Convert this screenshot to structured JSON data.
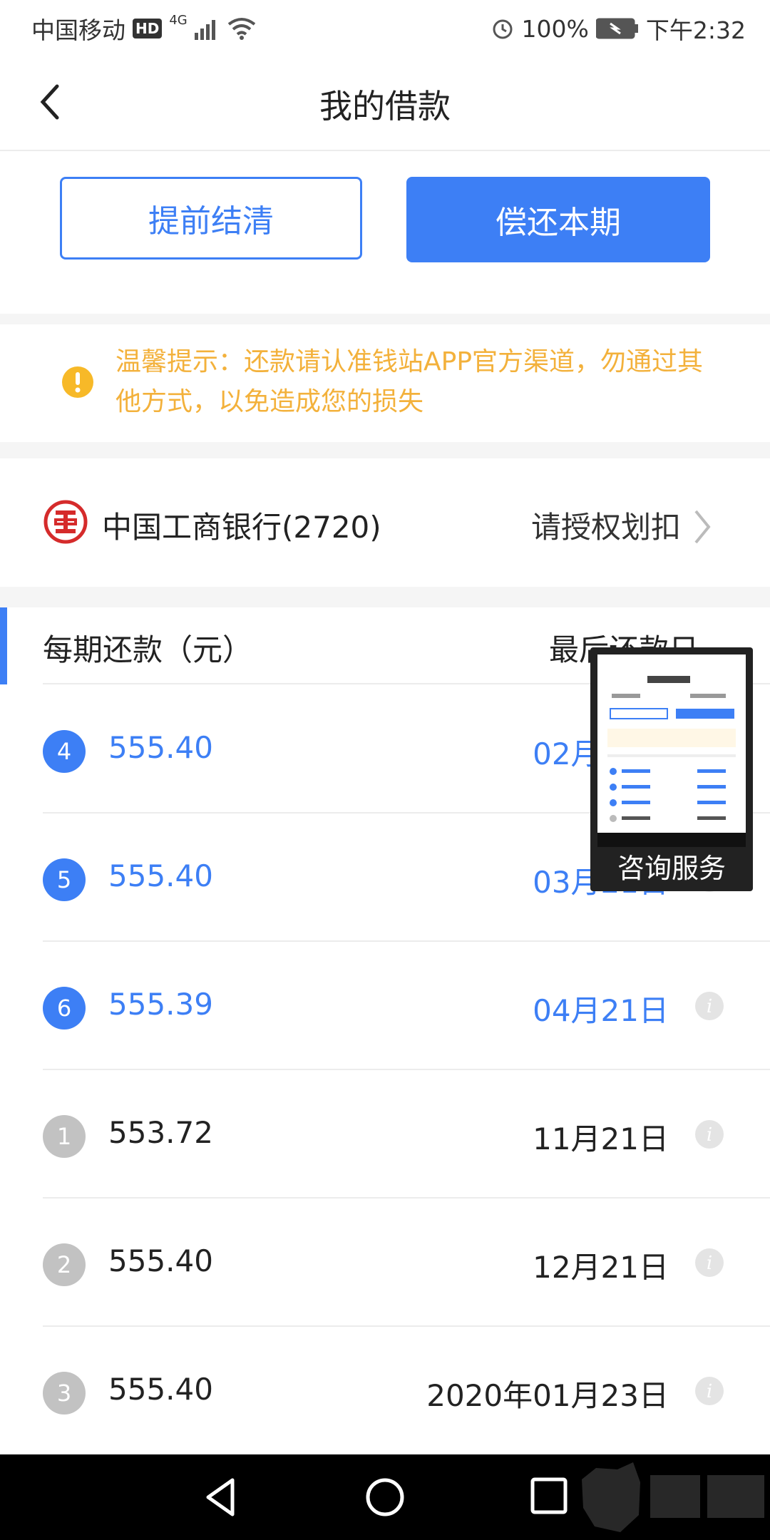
{
  "status_bar": {
    "carrier": "中国移动",
    "hd": "HD",
    "network": "4G",
    "battery": "100%",
    "time": "下午2:32"
  },
  "nav": {
    "title": "我的借款"
  },
  "actions": {
    "early_settle": "提前结清",
    "repay_current": "偿还本期"
  },
  "notice": {
    "text": "温馨提示：还款请认准钱站APP官方渠道，勿通过其他方式，以免造成您的损失"
  },
  "bank": {
    "name": "中国工商银行(2720)",
    "action": "请授权划扣"
  },
  "list": {
    "header_left": "每期还款（元）",
    "header_right": "最后还款日",
    "rows": [
      {
        "index": "4",
        "amount": "555.40",
        "date": "02月21日",
        "status": "pending"
      },
      {
        "index": "5",
        "amount": "555.40",
        "date": "03月21日",
        "status": "pending"
      },
      {
        "index": "6",
        "amount": "555.39",
        "date": "04月21日",
        "status": "pending"
      },
      {
        "index": "1",
        "amount": "553.72",
        "date": "11月21日",
        "status": "paid"
      },
      {
        "index": "2",
        "amount": "555.40",
        "date": "12月21日",
        "status": "paid"
      },
      {
        "index": "3",
        "amount": "555.40",
        "date": "2020年01月23日",
        "status": "paid"
      }
    ]
  },
  "consult": {
    "label": "咨询服务"
  },
  "colors": {
    "accent": "#3d7ff5",
    "notice": "#f3b13b",
    "badge_paid": "#c2c2c2"
  }
}
